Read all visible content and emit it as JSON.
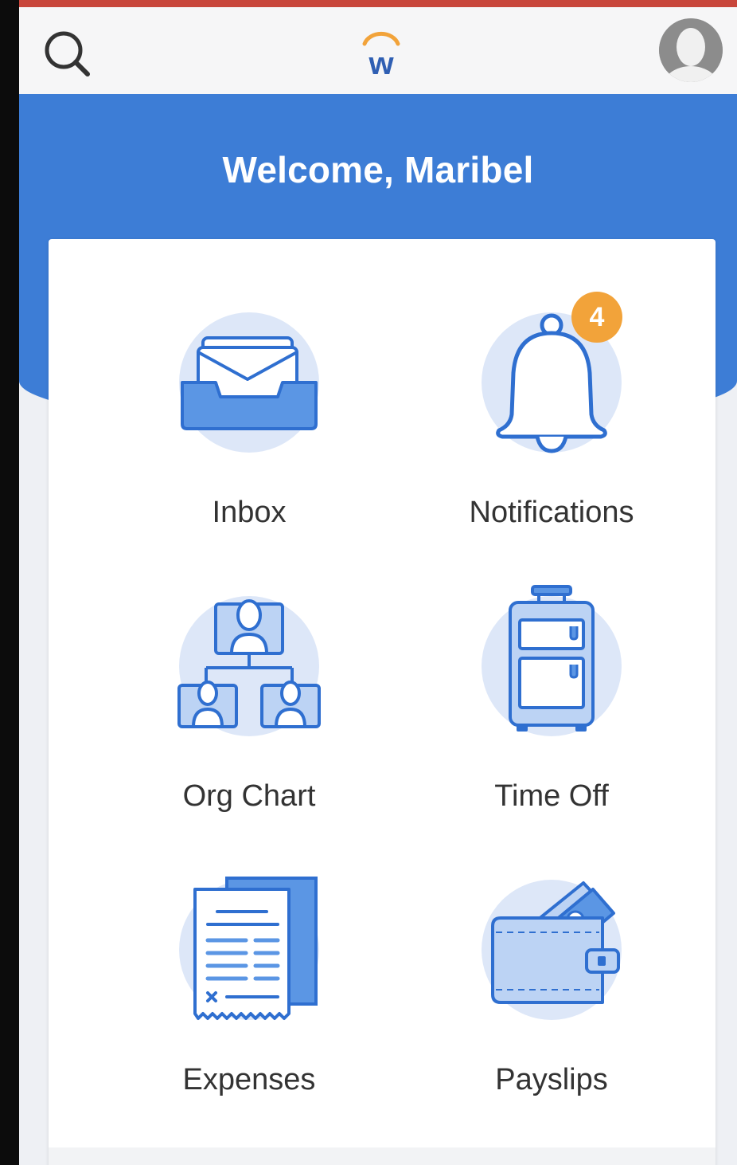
{
  "header": {
    "search_icon": "search-icon",
    "logo_letter": "w",
    "avatar_icon": "user-avatar-icon"
  },
  "welcome": {
    "text": "Welcome, Maribel"
  },
  "tiles": [
    {
      "label": "Inbox",
      "icon": "inbox-tray-icon"
    },
    {
      "label": "Notifications",
      "icon": "bell-icon",
      "badge": "4"
    },
    {
      "label": "Org Chart",
      "icon": "org-chart-icon"
    },
    {
      "label": "Time Off",
      "icon": "suitcase-icon"
    },
    {
      "label": "Expenses",
      "icon": "receipt-icon"
    },
    {
      "label": "Payslips",
      "icon": "wallet-icon"
    }
  ],
  "colors": {
    "brand_blue": "#3d7dd6",
    "icon_blue": "#2f6fd0",
    "icon_fill": "#bcd3f4",
    "circle_bg": "#dde7f8",
    "badge_orange": "#f2a33a",
    "logo_orange": "#f2a33a",
    "status_strip": "#c8463b"
  }
}
